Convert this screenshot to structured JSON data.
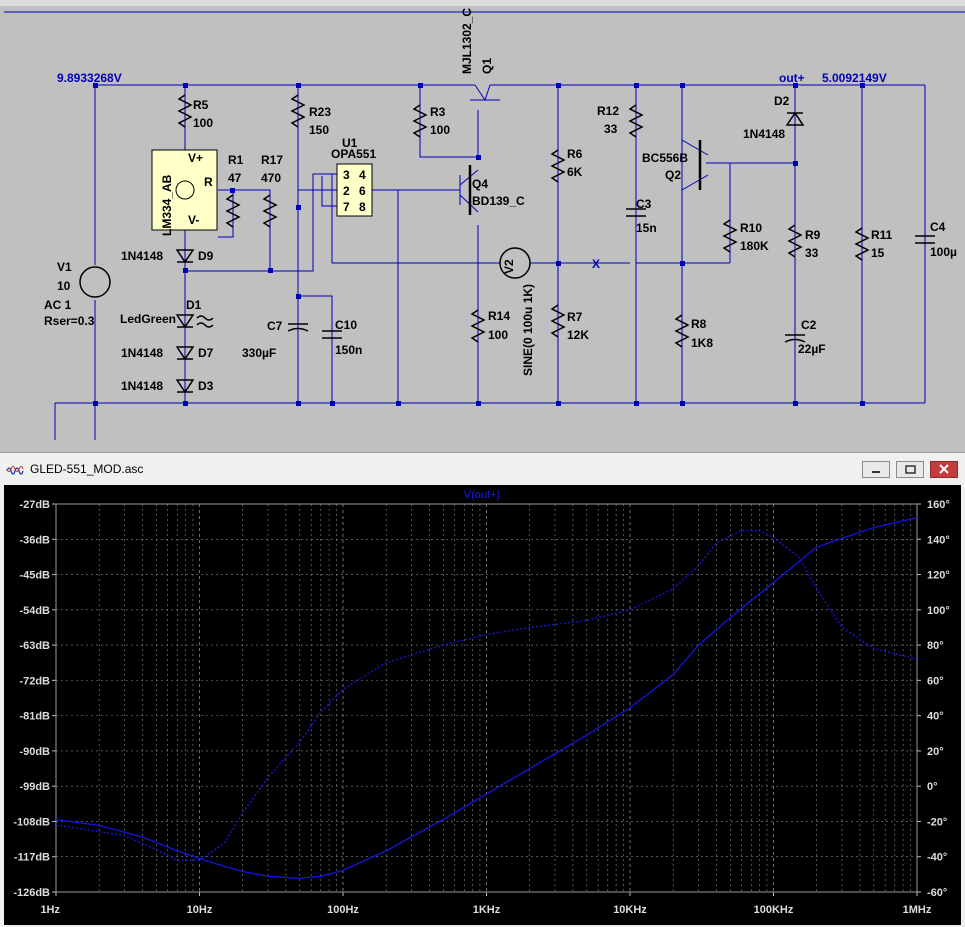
{
  "schematic": {
    "nodes": {
      "vin": "9.8933268V",
      "vout_name": "out+",
      "vout": "5.0092149V",
      "probe": "X"
    },
    "sources": {
      "v1": {
        "name": "V1",
        "value": "10",
        "ac": "AC 1",
        "rser": "Rser=0.3"
      },
      "v2": {
        "name": "V2",
        "value": "SINE(0 100u 1K)"
      }
    },
    "ic": {
      "name": "U1",
      "part": "OPA551",
      "pins": [
        "3",
        "4",
        "2",
        "6",
        "7",
        "8"
      ],
      "lm_name": "LM334_AB",
      "lm_vp": "V+",
      "lm_r": "R",
      "lm_vm": "V-"
    },
    "transistors": {
      "q1": {
        "name": "Q1",
        "part": "MJL1302_C"
      },
      "q4": {
        "name": "Q4",
        "part": "BD139_C"
      },
      "q2": {
        "name": "Q2",
        "part": "BC556B"
      }
    },
    "resistors": {
      "r5": [
        "R5",
        "100"
      ],
      "r1": [
        "R1",
        "47"
      ],
      "r17": [
        "R17",
        "470"
      ],
      "r23": [
        "R23",
        "150"
      ],
      "r3": [
        "R3",
        "100"
      ],
      "r14": [
        "R14",
        "100"
      ],
      "r6": [
        "R6",
        "6K"
      ],
      "r7": [
        "R7",
        "12K"
      ],
      "r12": [
        "R12",
        "33"
      ],
      "r10": [
        "R10",
        "180K"
      ],
      "r8": [
        "R8",
        "1K8"
      ],
      "r9": [
        "R9",
        "33"
      ],
      "r11": [
        "R11",
        "15"
      ]
    },
    "capacitors": {
      "c7": [
        "C7",
        "330µF"
      ],
      "c10": [
        "C10",
        "150n"
      ],
      "c3": [
        "C3",
        "15n"
      ],
      "c2": [
        "C2",
        "22µF"
      ],
      "c4": [
        "C4",
        "100µ"
      ]
    },
    "diodes": {
      "d9": [
        "1N4148",
        "D9"
      ],
      "d1": [
        "LedGreen",
        "D1"
      ],
      "d7": [
        "1N4148",
        "D7"
      ],
      "d3": [
        "1N4148",
        "D3"
      ],
      "d2": [
        "D2",
        "1N4148"
      ]
    }
  },
  "plot_window": {
    "title": "GLED-551_MOD.asc",
    "buttons": {
      "minimize": "minimize",
      "maximize": "maximize",
      "close": "close"
    }
  },
  "chart_data": {
    "type": "line",
    "title": "V(out+)",
    "x_scale": "log",
    "x_range": [
      1,
      1000000
    ],
    "x_ticks": [
      "1Hz",
      "10Hz",
      "100Hz",
      "1KHz",
      "10KHz",
      "100KHz",
      "1MHz"
    ],
    "y_left_range": [
      -126,
      -27
    ],
    "y_left_ticks": [
      "-27dB",
      "-36dB",
      "-45dB",
      "-54dB",
      "-63dB",
      "-72dB",
      "-81dB",
      "-90dB",
      "-99dB",
      "-108dB",
      "-117dB",
      "-126dB"
    ],
    "y_right_range": [
      -60,
      160
    ],
    "y_right_ticks": [
      "160°",
      "140°",
      "120°",
      "100°",
      "80°",
      "60°",
      "40°",
      "20°",
      "0°",
      "-20°",
      "-40°",
      "-60°"
    ],
    "grid": true,
    "colors": {
      "background": "#000000",
      "trace": "#1414d4",
      "grid": "#8a8a8a",
      "title": "#1a1aff"
    },
    "series": [
      {
        "name": "V(out+)",
        "style": "solid",
        "axis": "left",
        "x": [
          1,
          2,
          4,
          7,
          10,
          15,
          20,
          30,
          50,
          70,
          100,
          200,
          500,
          1000,
          2000,
          5000,
          10000,
          20000,
          30000,
          50000,
          100000,
          200000,
          500000,
          1000000
        ],
        "y": [
          -107.5,
          -109,
          -112,
          -115.5,
          -117.5,
          -119.5,
          -120.8,
          -122,
          -122.5,
          -122,
          -120.5,
          -115.5,
          -107.5,
          -101,
          -94.5,
          -86,
          -79,
          -70.5,
          -63,
          -56,
          -47,
          -38,
          -33,
          -30.5
        ]
      },
      {
        "name": "phase",
        "style": "dashed",
        "axis": "right",
        "x": [
          1,
          3,
          5,
          7,
          10,
          15,
          20,
          30,
          50,
          70,
          100,
          200,
          500,
          1000,
          2000,
          5000,
          10000,
          20000,
          30000,
          40000,
          60000,
          80000,
          100000,
          150000,
          200000,
          300000,
          500000,
          1000000
        ],
        "y": [
          -22,
          -28,
          -36,
          -42,
          -42,
          -32,
          -15,
          5,
          25,
          42,
          55,
          70,
          80,
          86,
          90,
          94,
          100,
          112,
          125,
          138,
          145,
          145,
          141,
          130,
          112,
          90,
          78,
          72
        ]
      }
    ]
  }
}
